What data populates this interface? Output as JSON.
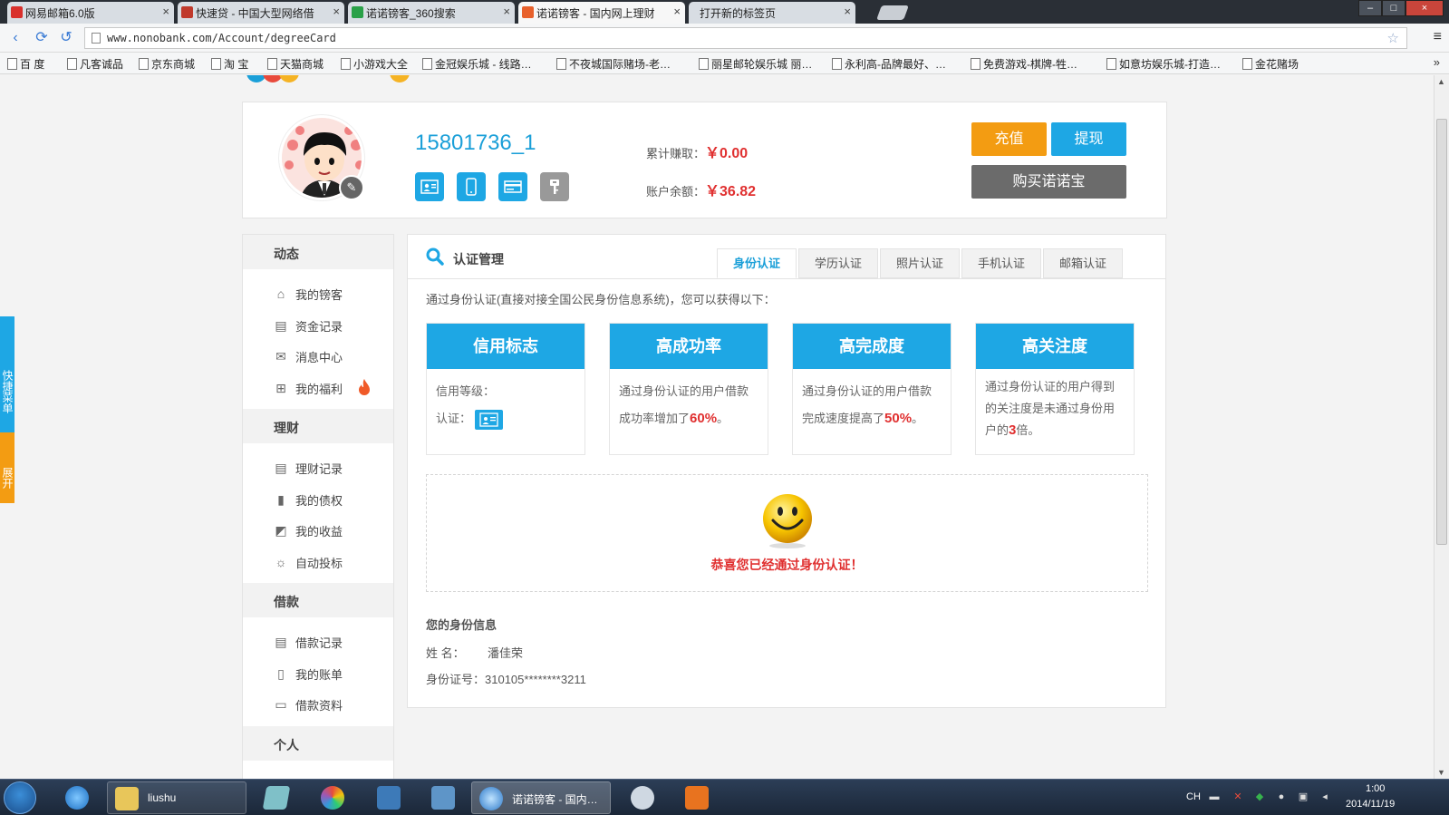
{
  "browser": {
    "tabs": [
      {
        "title": "网易邮箱6.0版",
        "favicon_color": "#d9302c"
      },
      {
        "title": "快速贷 - 中国大型网络借",
        "favicon_color": "#c0392b"
      },
      {
        "title": "诺诺镑客_360搜索",
        "favicon_color": "#2aa148"
      },
      {
        "title": "诺诺镑客 - 国内网上理财",
        "favicon_color": "#e8612c",
        "active": true
      },
      {
        "title": "打开新的标签页",
        "favicon_color": ""
      }
    ],
    "url": "www.nonobank.com/Account/degreeCard",
    "bookmarks": [
      "百 度",
      "凡客诚品",
      "京东商城",
      "淘 宝",
      "天猫商城",
      "小游戏大全",
      "金冠娱乐城 - 线路…",
      "不夜城国际赌场-老…",
      "丽星邮轮娱乐城 丽…",
      "永利高-品牌最好、…",
      "免费游戏-棋牌-牲…",
      "如意坊娱乐城-打造…",
      "金花赌场"
    ],
    "bookmarks_more": "»"
  },
  "quick_menu": {
    "top": "快捷菜单",
    "bottom": "展开"
  },
  "profile": {
    "username": "15801736_1",
    "earned_label": "累计赚取：",
    "earned_value": "￥0.00",
    "balance_label": "账户余额：",
    "balance_value": "￥36.82",
    "recharge_button": "充值",
    "withdraw_button": "提现",
    "buy_button": "购买诺诺宝"
  },
  "sidebar": {
    "sections": [
      {
        "title": "动态",
        "items": [
          {
            "label": "我的镑客",
            "icon": "home-icon",
            "glyph": "⌂"
          },
          {
            "label": "资金记录",
            "icon": "record-icon",
            "glyph": "▤"
          },
          {
            "label": "消息中心",
            "icon": "mail-icon",
            "glyph": "✉"
          },
          {
            "label": "我的福利",
            "icon": "gift-icon",
            "glyph": "⊞",
            "hot": true
          }
        ]
      },
      {
        "title": "理财",
        "items": [
          {
            "label": "理财记录",
            "icon": "document-icon",
            "glyph": "▤"
          },
          {
            "label": "我的债权",
            "icon": "bond-icon",
            "glyph": "▮"
          },
          {
            "label": "我的收益",
            "icon": "chart-icon",
            "glyph": "◩"
          },
          {
            "label": "自动投标",
            "icon": "bulb-icon",
            "glyph": "☼"
          }
        ]
      },
      {
        "title": "借款",
        "items": [
          {
            "label": "借款记录",
            "icon": "document-icon",
            "glyph": "▤"
          },
          {
            "label": "我的账单",
            "icon": "bill-icon",
            "glyph": "▯"
          },
          {
            "label": "借款资料",
            "icon": "clipboard-icon",
            "glyph": "▭"
          }
        ]
      },
      {
        "title": "个人",
        "items": []
      }
    ]
  },
  "main": {
    "title": "认证管理",
    "tabs": [
      "身份认证",
      "学历认证",
      "照片认证",
      "手机认证",
      "邮箱认证"
    ],
    "active_tab": "身份认证",
    "intro": "通过身份认证(直接对接全国公民身份信息系统)，您可以获得以下：",
    "cards": [
      {
        "title": "信用标志",
        "line1": "信用等级：",
        "line2": "认证："
      },
      {
        "title": "高成功率",
        "text": "通过身份认证的用户借款成功率增加了",
        "highlight": "60%",
        "suffix": "。"
      },
      {
        "title": "高完成度",
        "text": "通过身份认证的用户借款完成速度提高了",
        "highlight": "50%",
        "suffix": "。"
      },
      {
        "title": "高关注度",
        "text": "通过身份认证的用户得到的关注度是未通过身份用户的",
        "highlight": "3",
        "suffix": "倍。"
      }
    ],
    "success_message": "恭喜您已经通过身份认证！",
    "info_title": "您的身份信息",
    "name_label": "姓 名：",
    "name_value": "潘佳荣",
    "id_label": "身份证号：",
    "id_value": "310105********3211"
  },
  "taskbar": {
    "explorer_label": "liushu",
    "browser_label": "诺诺镑客 - 国内…",
    "lang": "CH",
    "time": "1:00",
    "date": "2014/11/19"
  }
}
